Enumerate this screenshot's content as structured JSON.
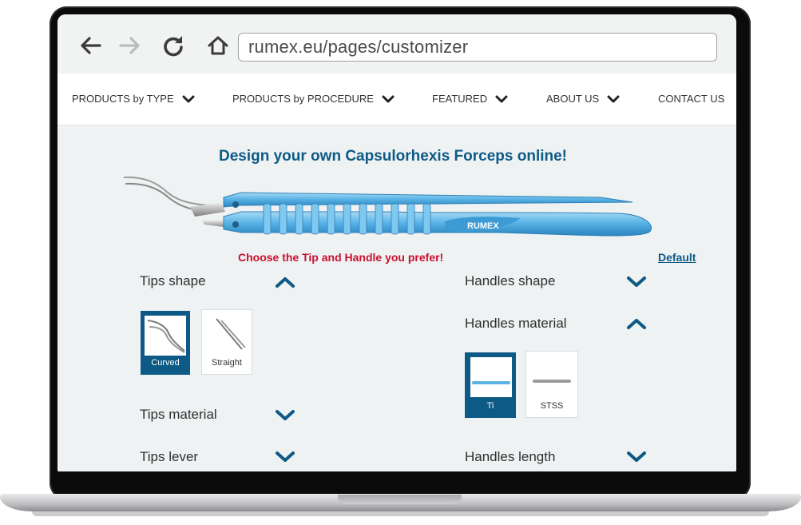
{
  "browser": {
    "url": "rumex.eu/pages/customizer",
    "icons": [
      "back-arrow-icon",
      "forward-arrow-icon",
      "reload-icon",
      "home-icon"
    ]
  },
  "nav": {
    "items": [
      {
        "label": "PRODUCTS by TYPE"
      },
      {
        "label": "PRODUCTS by PROCEDURE"
      },
      {
        "label": "FEATURED"
      },
      {
        "label": "ABOUT US"
      },
      {
        "label": "CONTACT US"
      }
    ]
  },
  "page": {
    "title": "Design your own Capsulorhexis Forceps online!",
    "prompt": "Choose the Tip and Handle you prefer!",
    "default_link": "Default",
    "brand_logo": "RUMEX"
  },
  "left": {
    "tips_shape": {
      "label": "Tips shape",
      "state": "expanded",
      "options": [
        {
          "label": "Curved",
          "selected": true
        },
        {
          "label": "Straight",
          "selected": false
        }
      ]
    },
    "tips_material": {
      "label": "Tips material",
      "state": "collapsed"
    },
    "tips_lever": {
      "label": "Tips lever",
      "state": "collapsed"
    }
  },
  "right": {
    "handles_shape": {
      "label": "Handles shape",
      "state": "collapsed"
    },
    "handles_material": {
      "label": "Handles material",
      "state": "expanded",
      "options": [
        {
          "label": "Ti",
          "selected": true
        },
        {
          "label": "STSS",
          "selected": false
        }
      ]
    },
    "handles_length": {
      "label": "Handles length",
      "state": "collapsed"
    }
  },
  "colors": {
    "accent": "#0d5a86",
    "prompt_red": "#c8102e",
    "content_bg": "#eef2f3",
    "instrument_blue": "#5ab4e6"
  }
}
